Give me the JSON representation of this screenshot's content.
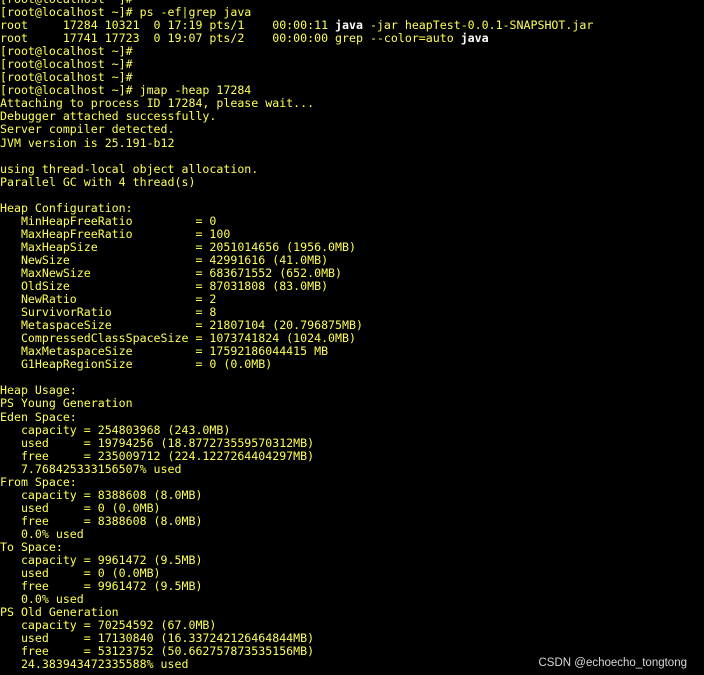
{
  "colors": {
    "background": "#000000",
    "foreground": "#ffff54",
    "highlight": "#ffffff",
    "watermark": "#d8d8d8"
  },
  "terminal": {
    "lines": [
      "[root@localhost ~]#",
      "[root@localhost ~]# ps -ef|grep java",
      "root     17284 10321  0 17:19 pts/1    00:00:11 java -jar heapTest-0.0.1-SNAPSHOT.jar",
      "root     17741 17723  0 19:07 pts/2    00:00:00 grep --color=auto java",
      "[root@localhost ~]#",
      "[root@localhost ~]#",
      "[root@localhost ~]#",
      "[root@localhost ~]# jmap -heap 17284",
      "Attaching to process ID 17284, please wait...",
      "Debugger attached successfully.",
      "Server compiler detected.",
      "JVM version is 25.191-b12",
      "",
      "using thread-local object allocation.",
      "Parallel GC with 4 thread(s)",
      "",
      "Heap Configuration:",
      "   MinHeapFreeRatio         = 0",
      "   MaxHeapFreeRatio         = 100",
      "   MaxHeapSize              = 2051014656 (1956.0MB)",
      "   NewSize                  = 42991616 (41.0MB)",
      "   MaxNewSize               = 683671552 (652.0MB)",
      "   OldSize                  = 87031808 (83.0MB)",
      "   NewRatio                 = 2",
      "   SurvivorRatio            = 8",
      "   MetaspaceSize            = 21807104 (20.796875MB)",
      "   CompressedClassSpaceSize = 1073741824 (1024.0MB)",
      "   MaxMetaspaceSize         = 17592186044415 MB",
      "   G1HeapRegionSize         = 0 (0.0MB)",
      "",
      "Heap Usage:",
      "PS Young Generation",
      "Eden Space:",
      "   capacity = 254803968 (243.0MB)",
      "   used     = 19794256 (18.877273559570312MB)",
      "   free     = 235009712 (224.1227264404297MB)",
      "   7.768425333156507% used",
      "From Space:",
      "   capacity = 8388608 (8.0MB)",
      "   used     = 0 (0.0MB)",
      "   free     = 8388608 (8.0MB)",
      "   0.0% used",
      "To Space:",
      "   capacity = 9961472 (9.5MB)",
      "   used     = 0 (0.0MB)",
      "   free     = 9961472 (9.5MB)",
      "   0.0% used",
      "PS Old Generation",
      "   capacity = 70254592 (67.0MB)",
      "   used     = 17130840 (16.337242126464844MB)",
      "   free     = 53123752 (50.662757873535156MB)",
      "   24.383943472335588% used"
    ],
    "highlight_word": "java"
  },
  "watermark": {
    "text": "CSDN @echoecho_tongtong"
  }
}
